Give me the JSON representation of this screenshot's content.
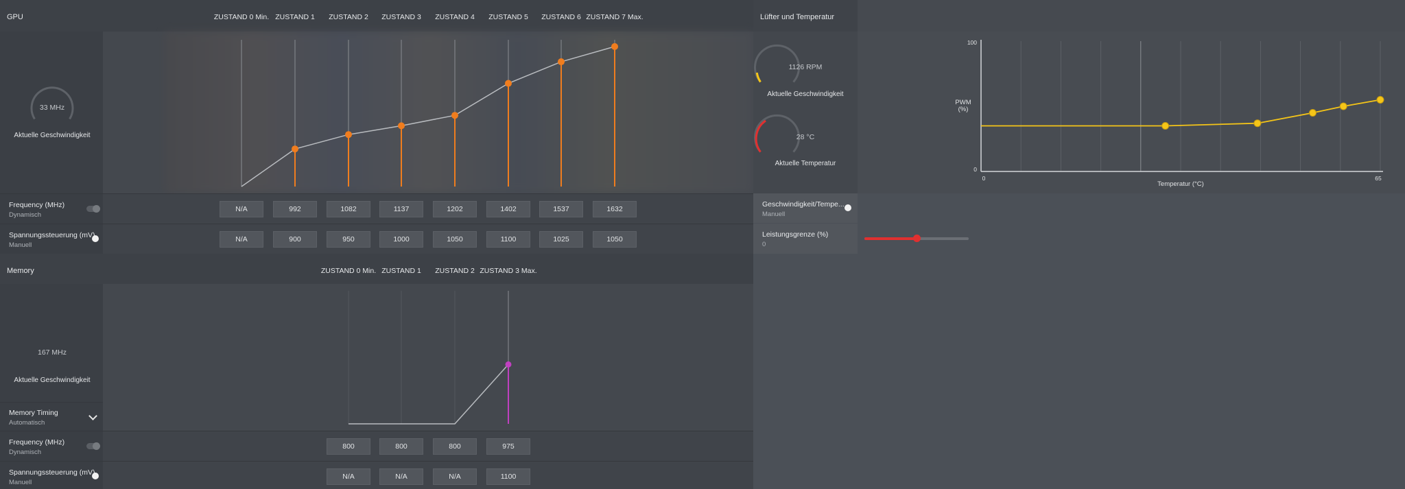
{
  "gpu": {
    "title": "GPU",
    "states": [
      "ZUSTAND 0 Min.",
      "ZUSTAND 1",
      "ZUSTAND 2",
      "ZUSTAND 3",
      "ZUSTAND 4",
      "ZUSTAND 5",
      "ZUSTAND 6",
      "ZUSTAND 7 Max."
    ],
    "gauge_value": "33 MHz",
    "gauge_label": "Aktuelle Geschwindigkeit",
    "frequency": {
      "title": "Frequency (MHz)",
      "mode": "Dynamisch",
      "values": [
        "N/A",
        "992",
        "1082",
        "1137",
        "1202",
        "1402",
        "1537",
        "1632"
      ]
    },
    "voltage": {
      "title": "Spannungssteuerung (mV)",
      "mode": "Manuell",
      "values": [
        "N/A",
        "900",
        "950",
        "1000",
        "1050",
        "1100",
        "1025",
        "1050"
      ]
    },
    "curve_color": "#f07d1e"
  },
  "memory": {
    "title": "Memory",
    "states": [
      "ZUSTAND 0 Min.",
      "ZUSTAND 1",
      "ZUSTAND 2",
      "ZUSTAND 3 Max."
    ],
    "gauge_value": "167 MHz",
    "gauge_label": "Aktuelle Geschwindigkeit",
    "timing": {
      "title": "Memory Timing",
      "mode": "Automatisch"
    },
    "frequency": {
      "title": "Frequency (MHz)",
      "mode": "Dynamisch",
      "values": [
        "800",
        "800",
        "800",
        "975"
      ]
    },
    "voltage": {
      "title": "Spannungssteuerung (mV)",
      "mode": "Manuell",
      "values": [
        "N/A",
        "N/A",
        "N/A",
        "1100"
      ]
    },
    "point_color": "#c040c0"
  },
  "fan": {
    "title": "Lüfter und Temperatur",
    "speed_value": "1126 RPM",
    "speed_label": "Aktuelle Geschwindigkeit",
    "temp_value": "28 °C",
    "temp_label": "Aktuelle Temperatur",
    "speed_control": {
      "title": "Geschwindigkeit/Tempe...",
      "mode": "Manuell"
    },
    "power_limit": {
      "title": "Leistungsgrenze (%)",
      "value": "0",
      "slider_fraction": 0.5
    },
    "accent_speed": "#f5c518",
    "accent_temp": "#e03030",
    "slider_color": "#e03030"
  },
  "chart_data": {
    "type": "line",
    "ylabel": "PWM\n(%)",
    "xlabel": "Temperatur (°C)",
    "ytick_top": "100",
    "ytick_bottom": "0",
    "xtick_left": "0",
    "xtick_right": "65",
    "xlim": [
      0,
      65
    ],
    "ylim": [
      0,
      100
    ],
    "line_color": "#f5c518",
    "points": [
      {
        "x": 0,
        "y": 35
      },
      {
        "x": 30,
        "y": 35
      },
      {
        "x": 45,
        "y": 37
      },
      {
        "x": 54,
        "y": 45
      },
      {
        "x": 59,
        "y": 50
      },
      {
        "x": 65,
        "y": 55
      }
    ],
    "marker_start_index": 1
  }
}
